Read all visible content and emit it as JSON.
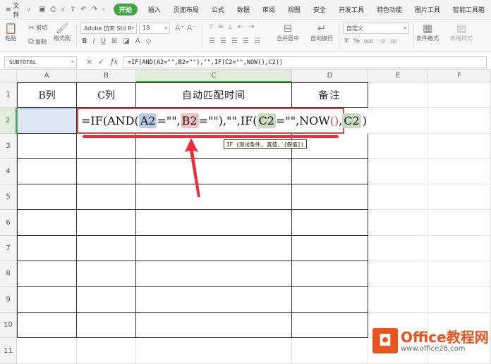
{
  "menubar": {
    "file_label": "文件",
    "tabs": [
      "开始",
      "插入",
      "页面布局",
      "公式",
      "数据",
      "审阅",
      "视图",
      "安全",
      "开发工具",
      "特色功能",
      "图片工具",
      "智能工具箱"
    ],
    "active_tab": "开始"
  },
  "ribbon": {
    "paste_label": "粘贴",
    "cut_label": "剪切",
    "copy_label": "复制",
    "format_painter_label": "格式刷",
    "font_name": "Adobe 仿宋 Std R",
    "font_size": "18",
    "bold_label": "B",
    "italic_label": "I",
    "underline_label": "U",
    "merge_center_label": "合并居中",
    "wrap_text_label": "自动换行",
    "number_format": "自定义",
    "percent_label": "%",
    "thousands_label": "000",
    "conditional_format_label": "条件格式",
    "table_style_label": "表格样式"
  },
  "formula_bar": {
    "name_box": "SUBTOTAL",
    "cancel_icon": "×",
    "confirm_icon": "✓",
    "fx_label": "fx",
    "formula": "=IF(AND(A2=\"\",B2=\"\"),\"\",IF(C2=\"\",NOW(),C2))"
  },
  "sheet": {
    "columns": [
      "A",
      "B",
      "C",
      "D",
      "E",
      "F"
    ],
    "rows": [
      "1",
      "2",
      "3",
      "4",
      "5",
      "6",
      "7",
      "8",
      "9",
      "10",
      "11"
    ],
    "headers": {
      "A1": "B列",
      "B1": "C列",
      "C1": "自动匹配时间",
      "D1": "备注"
    },
    "editing_formula_parts": {
      "p1": "=IF(AND(",
      "ref_a2": "A2",
      "p2": "=\"\",",
      "ref_b2": "B2",
      "p3": "=\"\"),\"\",IF(",
      "ref_c2": "C2",
      "p4": "=\"\",NOW",
      "paren": "()",
      "p5": ",",
      "ref_c2b": "C2",
      "p6": ")"
    },
    "tooltip": "IF (测试条件, 真值, [假值])"
  },
  "watermark": {
    "brand": "Office教程网",
    "url": "www.office26.com"
  }
}
